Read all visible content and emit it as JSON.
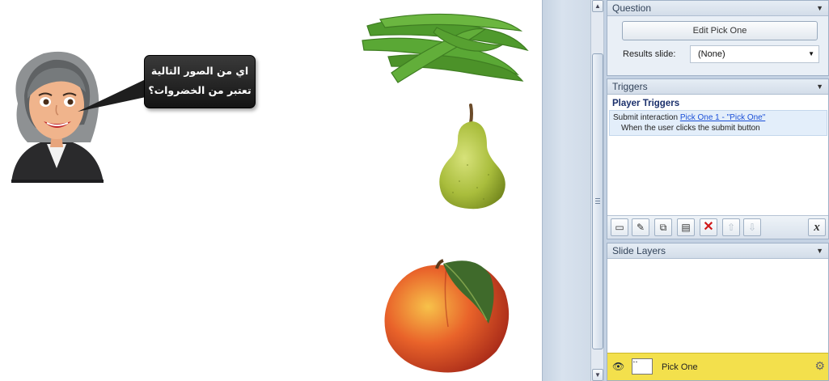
{
  "slide": {
    "speech_bubble": {
      "line1": "اي من الصور التالية",
      "line2": "تعتبر من الخضروات؟"
    },
    "images": [
      "green-beans",
      "pear",
      "peach"
    ]
  },
  "question_panel": {
    "title": "Question",
    "edit_button": "Edit Pick One",
    "results_label": "Results slide:",
    "results_value": "(None)"
  },
  "triggers_panel": {
    "title": "Triggers",
    "group_title": "Player Triggers",
    "trigger": {
      "action": "Submit interaction",
      "target": "Pick One 1 - \"Pick One\"",
      "condition": "When the user clicks the submit button"
    },
    "toolbar": {
      "variables_label": "x"
    }
  },
  "layers_panel": {
    "title": "Slide Layers",
    "base_layer": "Pick One"
  },
  "colors": {
    "panel_bg": "#c4d2e3",
    "trigger_link": "#1a4fd8",
    "layer_highlight": "#f3e04c"
  }
}
